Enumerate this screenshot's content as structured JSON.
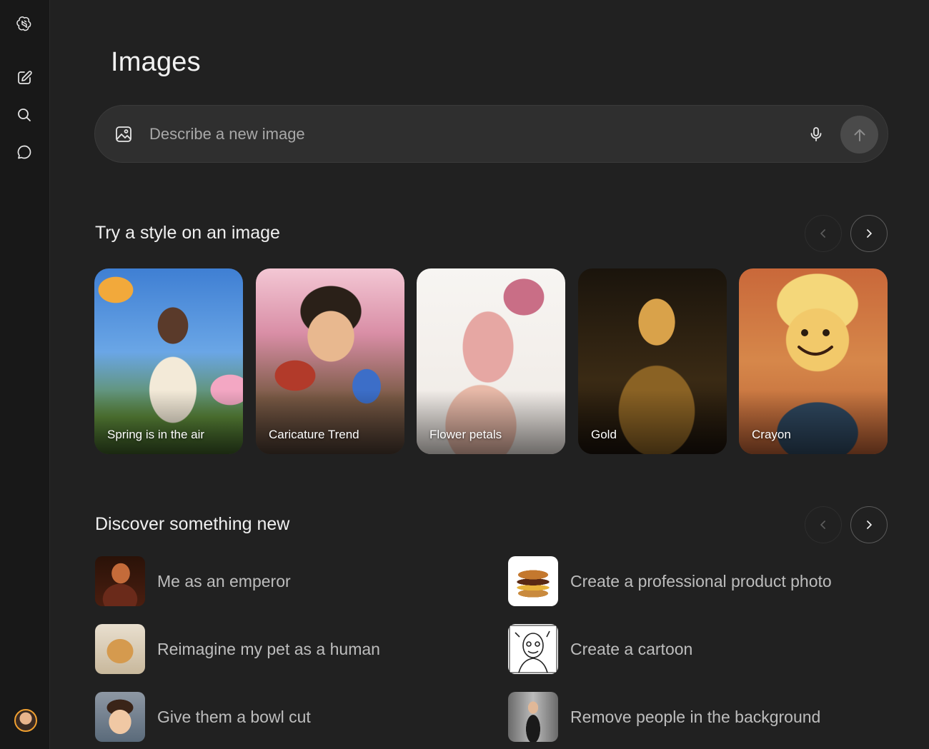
{
  "sidebar": {
    "logo": "openai-logo-icon",
    "items": [
      {
        "icon": "new-chat-icon"
      },
      {
        "icon": "search-icon"
      },
      {
        "icon": "chat-bubble-icon"
      }
    ],
    "avatar": "user-avatar"
  },
  "page": {
    "title": "Images"
  },
  "search": {
    "placeholder": "Describe a new image",
    "value": "",
    "left_icon": "image-icon",
    "mic_icon": "microphone-icon",
    "send_icon": "arrow-up-icon"
  },
  "styles_section": {
    "title": "Try a style on an image",
    "cards": [
      {
        "label": "Spring is in the air"
      },
      {
        "label": "Caricature Trend"
      },
      {
        "label": "Flower petals"
      },
      {
        "label": "Gold"
      },
      {
        "label": "Crayon"
      }
    ]
  },
  "discover_section": {
    "title": "Discover something new",
    "items": [
      {
        "label": "Me as an emperor"
      },
      {
        "label": "Create a professional product photo"
      },
      {
        "label": "Reimagine my pet as a human"
      },
      {
        "label": "Create a cartoon"
      },
      {
        "label": "Give them a bowl cut"
      },
      {
        "label": "Remove people in the background"
      }
    ]
  },
  "colors": {
    "background": "#212121",
    "sidebar": "#181818",
    "input": "#2f2f2f",
    "send_button": "#4a4a4a"
  }
}
